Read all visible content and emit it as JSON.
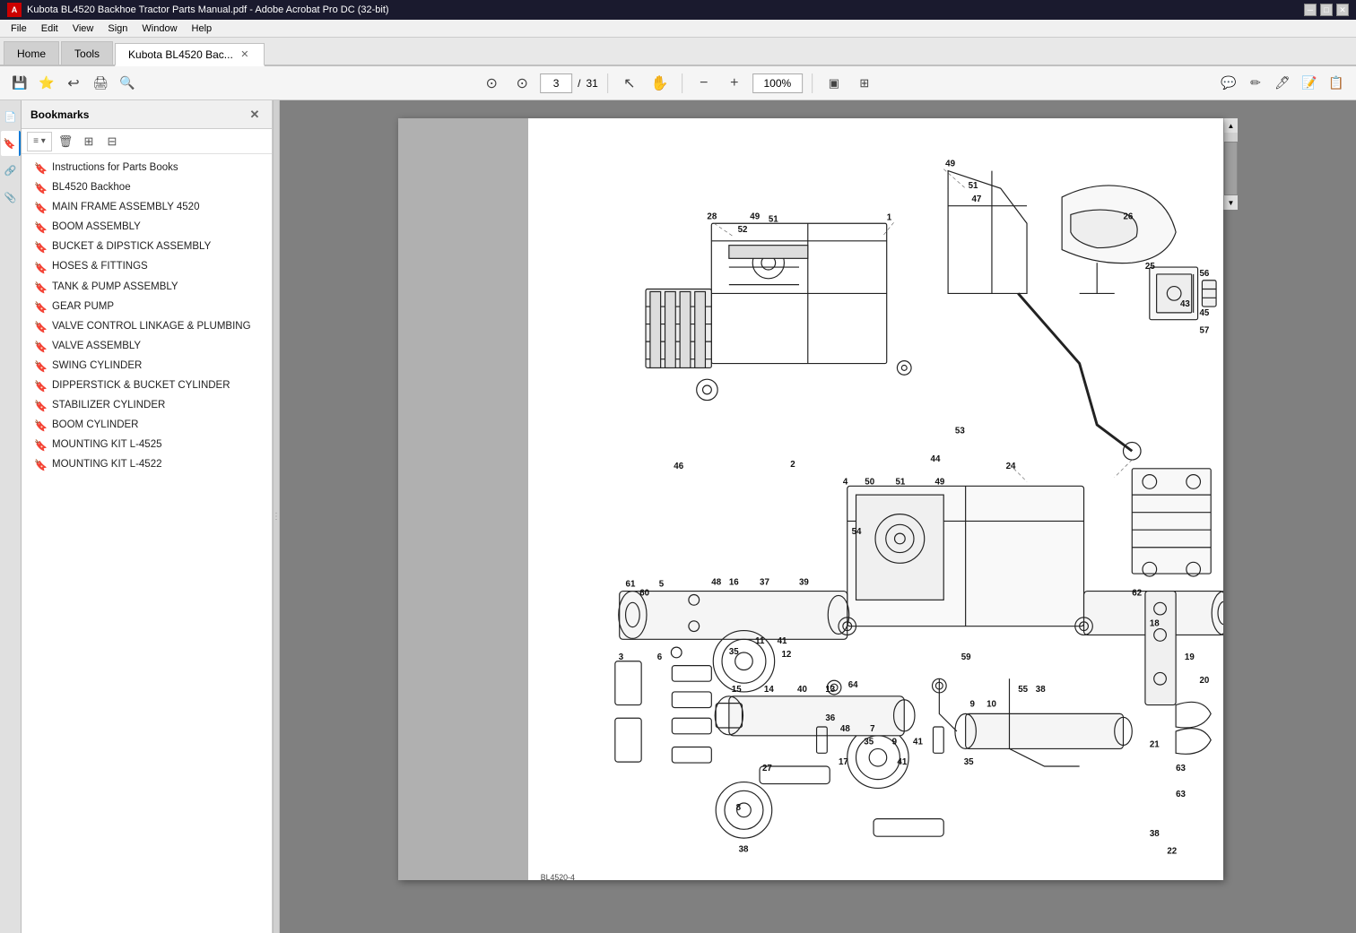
{
  "titlebar": {
    "title": "Kubota BL4520 Backhoe Tractor Parts Manual.pdf - Adobe Acrobat Pro DC (32-bit)",
    "icon_label": "A"
  },
  "menubar": {
    "items": [
      "File",
      "Edit",
      "View",
      "Sign",
      "Window",
      "Help"
    ]
  },
  "tabs": [
    {
      "id": "home",
      "label": "Home",
      "active": false,
      "closable": false
    },
    {
      "id": "tools",
      "label": "Tools",
      "active": false,
      "closable": false
    },
    {
      "id": "document",
      "label": "Kubota BL4520 Bac...",
      "active": true,
      "closable": true
    }
  ],
  "toolbar": {
    "left_icons": [
      "💾",
      "⭐",
      "↩",
      "🖨",
      "🔍"
    ],
    "nav": {
      "up_label": "▲",
      "down_label": "▼",
      "current_page": "3",
      "total_pages": "31"
    },
    "zoom": {
      "zoom_out_label": "−",
      "zoom_in_label": "+",
      "zoom_value": "100%"
    },
    "right_icons": [
      "cursor",
      "hand",
      "📄",
      "✏",
      "🖊",
      "💬",
      "🔖",
      "📋"
    ]
  },
  "bookmarks": {
    "title": "Bookmarks",
    "items": [
      {
        "label": "Instructions for Parts Books"
      },
      {
        "label": "BL4520 Backhoe"
      },
      {
        "label": "MAIN FRAME ASSEMBLY 4520"
      },
      {
        "label": "BOOM ASSEMBLY"
      },
      {
        "label": "BUCKET & DIPSTICK ASSEMBLY"
      },
      {
        "label": "HOSES & FITTINGS"
      },
      {
        "label": "TANK & PUMP ASSEMBLY"
      },
      {
        "label": "GEAR PUMP"
      },
      {
        "label": "VALVE CONTROL LINKAGE & PLUMBING"
      },
      {
        "label": "VALVE ASSEMBLY"
      },
      {
        "label": "SWING CYLINDER"
      },
      {
        "label": "DIPPERSTICK & BUCKET CYLINDER"
      },
      {
        "label": "STABILIZER CYLINDER"
      },
      {
        "label": "BOOM CYLINDER"
      },
      {
        "label": "MOUNTING KIT L-4525"
      },
      {
        "label": "MOUNTING KIT L-4522"
      }
    ]
  },
  "drawing": {
    "description": "Technical exploded parts diagram of Kubota BL4520 Backhoe Tractor"
  }
}
